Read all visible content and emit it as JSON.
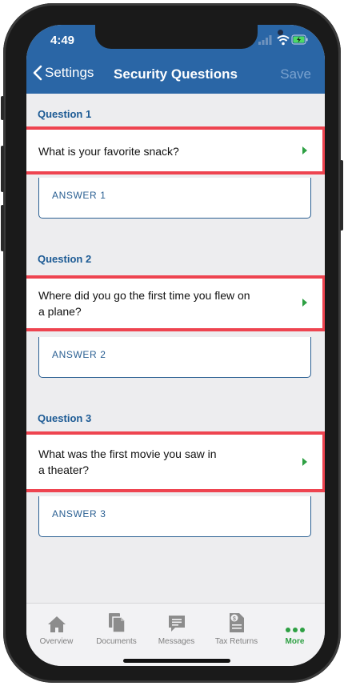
{
  "status_bar": {
    "time": "4:49"
  },
  "nav": {
    "back_label": "Settings",
    "title": "Security Questions",
    "save_label": "Save"
  },
  "questions": [
    {
      "label": "Question 1",
      "line1": "What is your favorite snack?",
      "line2": "",
      "answer_placeholder": "ANSWER 1"
    },
    {
      "label": "Question 2",
      "line1": "Where did you go the first time you flew on",
      "line2": "a plane?",
      "answer_placeholder": "ANSWER 2"
    },
    {
      "label": "Question 3",
      "line1": "What was the first movie you saw in",
      "line2": "a theater?",
      "answer_placeholder": "ANSWER 3"
    }
  ],
  "tabs": [
    {
      "label": "Overview",
      "icon": "home-icon"
    },
    {
      "label": "Documents",
      "icon": "documents-icon"
    },
    {
      "label": "Messages",
      "icon": "messages-icon"
    },
    {
      "label": "Tax Returns",
      "icon": "tax-returns-icon"
    },
    {
      "label": "More",
      "icon": "more-dots-icon",
      "active": true
    }
  ],
  "colors": {
    "header": "#2a66a6",
    "accent_green": "#2ea043",
    "highlight_red": "#ee4450",
    "label_blue": "#1c5a94"
  }
}
